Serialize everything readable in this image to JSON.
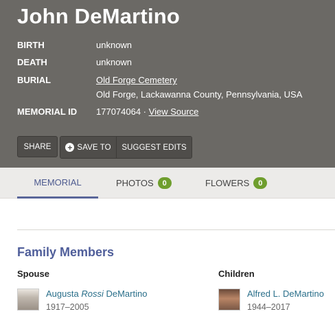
{
  "memorial": {
    "name": "John DeMartino",
    "facts": {
      "birth_label": "BIRTH",
      "birth_value": "unknown",
      "death_label": "DEATH",
      "death_value": "unknown",
      "burial_label": "BURIAL",
      "burial_cemetery": "Old Forge Cemetery",
      "burial_location": "Old Forge, Lackawanna County, Pennsylvania, USA",
      "memorial_id_label": "MEMORIAL ID",
      "memorial_id_value": "177074064 ·",
      "view_source": "View Source"
    }
  },
  "actions": {
    "share": "SHARE",
    "save_to": "SAVE TO",
    "suggest_edits": "SUGGEST EDITS"
  },
  "tabs": [
    {
      "label": "MEMORIAL",
      "active": true
    },
    {
      "label": "PHOTOS",
      "count": "0"
    },
    {
      "label": "FLOWERS",
      "count": "0"
    }
  ],
  "family": {
    "title": "Family Members",
    "spouse_label": "Spouse",
    "children_label": "Children",
    "spouse": {
      "first": "Augusta",
      "maiden": "Rossi",
      "last": "DeMartino",
      "dates": "1917–2005"
    },
    "child": {
      "name": "Alfred L. DeMartino",
      "dates": "1944–2017"
    }
  },
  "colors": {
    "header_bg": "#6b6965",
    "accent": "#4f5e9a",
    "link": "#2a6f8a",
    "badge": "#6f9e2e"
  }
}
